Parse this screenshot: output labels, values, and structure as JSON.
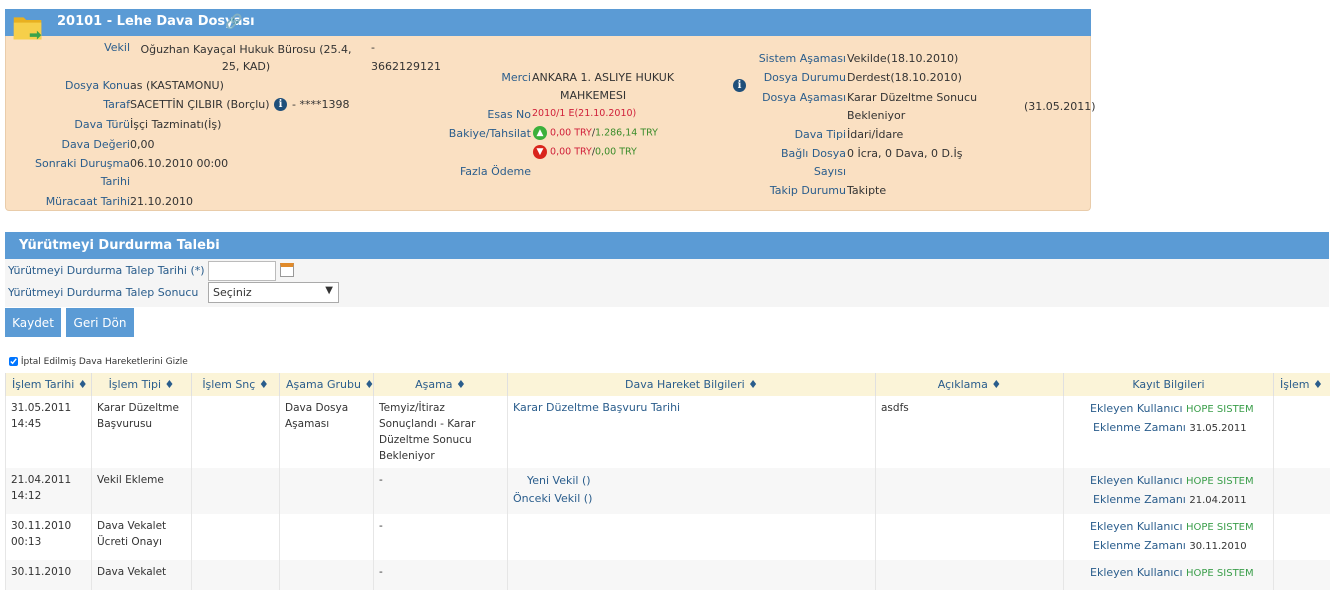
{
  "case": {
    "title": "20101 - Lehe Dava Dosyası",
    "vekil_label": "Vekil",
    "vekil_value": "Oğuzhan Kayaçal Hukuk Bürosu  (25.4, 25, KAD)",
    "vekil_dash": "-",
    "vekil_phone": "3662129121",
    "dosya_konu_label": "Dosya Konu",
    "dosya_konu_value": "as (KASTAMONU)",
    "taraf_label": "Taraf",
    "taraf_value": "SACETTİN ÇILBIR  (Borçlu)",
    "taraf_id": "- ****1398",
    "dava_turu_label": "Dava Türü",
    "dava_turu_value": "İşçi Tazminatı(İş)",
    "dava_degeri_label": "Dava Değeri",
    "dava_degeri_value": "0,00",
    "sonraki_label_1": "Sonraki Duruşma",
    "sonraki_label_2": "Tarihi",
    "sonraki_value": "06.10.2010 00:00",
    "muracaat_label": "Müracaat Tarihi",
    "muracaat_value": "21.10.2010",
    "merci_label": "Merci",
    "merci_value_1": "ANKARA 1. ASLIYE HUKUK",
    "merci_value_2": "MAHKEMESI",
    "esas_label": "Esas No",
    "esas_value": "2010/1 E(21.10.2010)",
    "bakiye_label": "Bakiye/Tahsilat",
    "bakiye_up_1": "0,00 TRY",
    "bakiye_up_2": "1.286,14 TRY",
    "bakiye_dn_1": "0,00 TRY",
    "bakiye_dn_2": "0,00 TRY",
    "fazla_label": "Fazla Ödeme",
    "sistem_label": "Sistem Aşaması",
    "sistem_value": "Vekilde(18.10.2010)",
    "durum_label": "Dosya Durumu",
    "durum_value": "Derdest(18.10.2010)",
    "asama_label": "Dosya Aşaması",
    "asama_value_1": "Karar Düzeltme Sonucu",
    "asama_value_2": "Bekleniyor",
    "asama_date": "(31.05.2011)",
    "dava_tipi_label": "Dava Tipi",
    "dava_tipi_value": "İdari/İdare",
    "bagli_label_1": "Bağlı Dosya",
    "bagli_label_2": "Sayısı",
    "bagli_value": "0 İcra, 0 Dava, 0 D.İş",
    "takip_label": "Takip Durumu",
    "takip_value": "Takipte"
  },
  "form": {
    "title": "Yürütmeyi Durdurma Talebi",
    "tarih_label": "Yürütmeyi Durdurma Talep Tarihi (*)",
    "tarih_value": "",
    "sonuc_label": "Yürütmeyi Durdurma Talep Sonucu",
    "sonuc_selected": "Seçiniz",
    "save": "Kaydet",
    "back": "Geri Dön"
  },
  "filter": {
    "label": "İptal Edilmiş Dava Hareketlerini Gizle",
    "checked": true
  },
  "table": {
    "headers": [
      "İşlem Tarihi ♦",
      "İşlem Tipi ♦",
      "İşlem Snç ♦",
      "Aşama Grubu ♦",
      "Aşama ♦",
      "Dava Hareket Bilgileri ♦",
      "Açıklama ♦",
      "Kayıt Bilgileri",
      "İşlem ♦"
    ],
    "added_user_label": "Ekleyen Kullanıcı",
    "added_time_label": "Eklenme Zamanı",
    "rows": [
      {
        "date": "31.05.2011",
        "time": "14:45",
        "type": "Karar Düzeltme Başvurusu",
        "result": "",
        "group": "Dava Dosya Aşaması",
        "stage": "Temyiz/İtiraz Sonuçlandı - Karar Düzeltme Sonucu Bekleniyor",
        "info": "Karar Düzeltme Başvuru Tarihi",
        "info2": "",
        "desc": "asdfs",
        "user": "HOPE SISTEM",
        "added": "31.05.2011"
      },
      {
        "date": "21.04.2011",
        "time": "14:12",
        "type": "Vekil Ekleme",
        "result": "",
        "group": "",
        "stage": "-",
        "info": "Yeni Vekil  ()",
        "info2": "Önceki Vekil  ()",
        "desc": "",
        "user": "HOPE SISTEM",
        "added": "21.04.2011"
      },
      {
        "date": "30.11.2010",
        "time": "00:13",
        "type": "Dava Vekalet Ücreti Onayı",
        "result": "",
        "group": "",
        "stage": "-",
        "info": "",
        "info2": "",
        "desc": "",
        "user": "HOPE SISTEM",
        "added": "30.11.2010"
      },
      {
        "date": "30.11.2010",
        "time": "",
        "type": "Dava Vekalet",
        "result": "",
        "group": "",
        "stage": "-",
        "info": "",
        "info2": "",
        "desc": "",
        "user": "HOPE SISTEM",
        "added": ""
      }
    ]
  }
}
